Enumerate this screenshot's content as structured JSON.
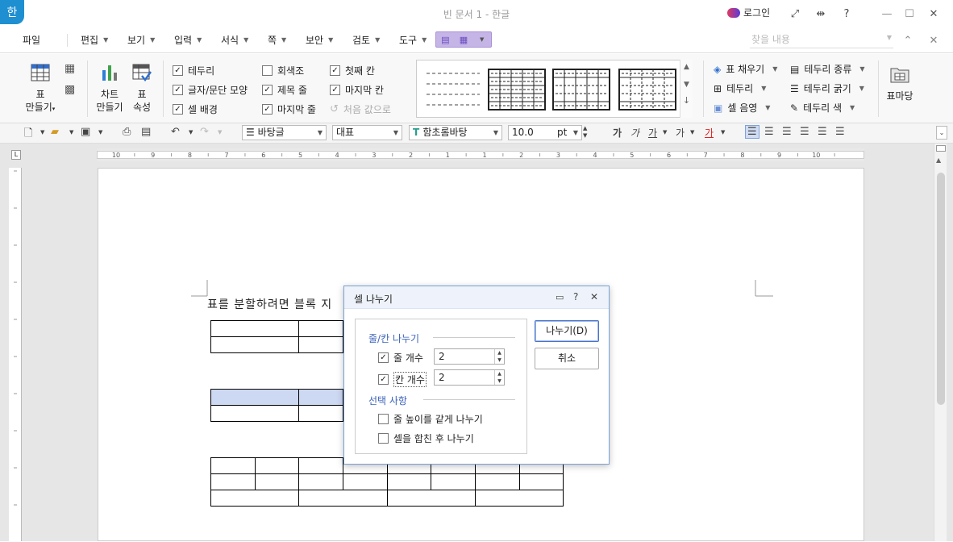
{
  "window": {
    "title": "빈 문서 1 - 한글",
    "app_icon": "한",
    "login": "로그인",
    "controls": [
      "⤢",
      "⇹",
      "?",
      "—",
      "☐",
      "✕"
    ]
  },
  "menubar": {
    "file": "파일",
    "items": [
      "편집",
      "보기",
      "입력",
      "서식",
      "쪽",
      "보안",
      "검토",
      "도구"
    ],
    "search_placeholder": "찾을 내용"
  },
  "ribbon": {
    "table_make": [
      "표",
      "만들기"
    ],
    "chart_make": [
      "차트",
      "만들기"
    ],
    "table_props": [
      "표",
      "속성"
    ],
    "checks_col1": [
      {
        "label": "테두리",
        "checked": true
      },
      {
        "label": "글자/문단 모양",
        "checked": true
      },
      {
        "label": "셀 배경",
        "checked": true
      }
    ],
    "checks_col2": [
      {
        "label": "회색조",
        "checked": false
      },
      {
        "label": "제목 줄",
        "checked": true
      },
      {
        "label": "마지막 줄",
        "checked": true
      }
    ],
    "checks_col3": [
      {
        "label": "첫째 칸",
        "checked": true
      },
      {
        "label": "마지막 칸",
        "checked": true
      },
      {
        "label": "처음 값으로",
        "checked": false,
        "disabled": true
      }
    ],
    "format_col1": [
      "표 채우기",
      "테두리",
      "셀 음영"
    ],
    "format_col2": [
      "테두리 종류",
      "테두리 굵기",
      "테두리 색"
    ],
    "table_format": "표마당"
  },
  "toolbar": {
    "style": "바탕글",
    "representative": "대표",
    "font": "함초롬바탕",
    "size": "10.0",
    "unit": "pt",
    "char_buttons": [
      "가",
      "가",
      "가",
      "가",
      "가"
    ]
  },
  "ruler": {
    "marks": [
      "10",
      "9",
      "8",
      "7",
      "6",
      "5",
      "4",
      "3",
      "2",
      "1",
      "1",
      "2",
      "3",
      "4",
      "5",
      "6",
      "7",
      "8",
      "9",
      "10"
    ]
  },
  "document": {
    "text": "표를 분할하려면 블록 지"
  },
  "dialog": {
    "title": "셀 나누기",
    "group1_label": "줄/칸 나누기",
    "rows_label": "줄 개수",
    "rows_value": "2",
    "rows_checked": true,
    "cols_label": "칸 개수",
    "cols_value": "2",
    "cols_checked": true,
    "group2_label": "선택 사항",
    "opt1_label": "줄 높이를 같게 나누기",
    "opt1_checked": false,
    "opt2_label": "셀을 합친 후 나누기",
    "opt2_checked": false,
    "ok_label": "나누기(D)",
    "cancel_label": "취소"
  }
}
